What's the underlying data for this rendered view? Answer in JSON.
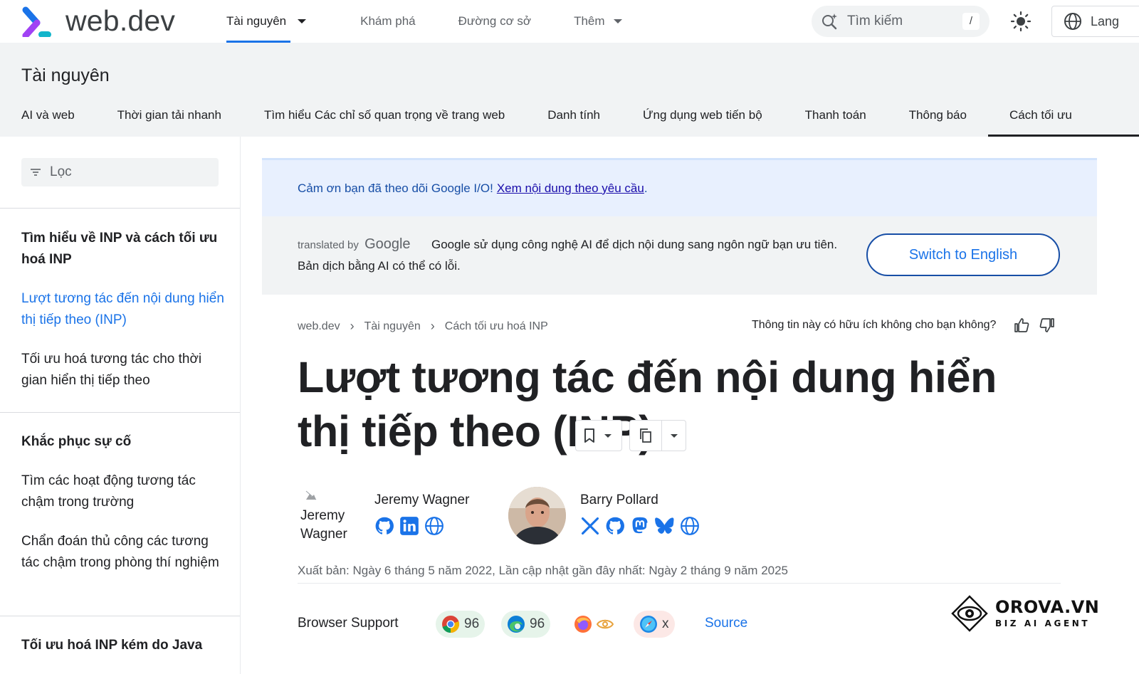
{
  "header": {
    "brand": "web.dev",
    "nav": [
      "Tài nguyên",
      "Khám phá",
      "Đường cơ sở",
      "Thêm"
    ],
    "search_placeholder": "Tìm kiếm",
    "search_shortcut": "/",
    "language_label": "Lang"
  },
  "section": {
    "title": "Tài nguyên",
    "tabs": [
      "AI và web",
      "Thời gian tải nhanh",
      "Tìm hiểu Các chỉ số quan trọng về trang web",
      "Danh tính",
      "Ứng dụng web tiến bộ",
      "Thanh toán",
      "Thông báo",
      "Cách tối ưu"
    ]
  },
  "sidebar": {
    "filter_placeholder": "Lọc",
    "group1_title": "Tìm hiểu về INP và cách tối ưu hoá INP",
    "item_active": "Lượt tương tác đến nội dung hiển thị tiếp theo (INP)",
    "item_optimize": "Tối ưu hoá tương tác cho thời gian hiển thị tiếp theo",
    "group2_title": "Khắc phục sự cố",
    "item_find_slow": "Tìm các hoạt động tương tác chậm trong trường",
    "item_diagnose": "Chẩn đoán thủ công các tương tác chậm trong phòng thí nghiệm",
    "group3_title": "Tối ưu hoá INP kém do Java"
  },
  "banner": {
    "text": "Cảm ơn bạn đã theo dõi Google I/O!",
    "link": "Xem nội dung theo yêu cầu",
    "end": "."
  },
  "translation": {
    "translated_by": "translated by",
    "google": "Google",
    "line1": "Google sử dụng công nghệ AI để dịch nội dung sang ngôn ngữ bạn ưu tiên.",
    "line2": "Bản dịch bằng AI có thể có lỗi.",
    "switch_button": "Switch to English"
  },
  "breadcrumb": [
    "web.dev",
    "Tài nguyên",
    "Cách tối ưu hoá INP"
  ],
  "helpful_question": "Thông tin này có hữu ích không cho bạn không?",
  "article": {
    "title": "Lượt tương tác đến nội dung hiển thị tiếp theo (INP)",
    "authors": [
      {
        "name": "Jeremy Wagner",
        "broken_alt": "Jeremy Wagner",
        "links": [
          "github-icon",
          "linkedin-icon",
          "globe-icon"
        ]
      },
      {
        "name": "Barry Pollard",
        "links": [
          "x-icon",
          "github-icon",
          "mastodon-icon",
          "bluesky-icon",
          "globe-icon"
        ]
      }
    ],
    "meta": "Xuất bản: Ngày 6 tháng 5 năm 2022, Lần cập nhật gần đây nhất: Ngày 2 tháng 9 năm 2025"
  },
  "browser_support": {
    "label": "Browser Support",
    "chrome": "96",
    "edge": "96",
    "firefox_status": "preview",
    "safari": "x",
    "source": "Source"
  },
  "watermark": {
    "name": "OROVA.VN",
    "tagline": "BIZ AI AGENT"
  },
  "colors": {
    "accent": "#1a73e8",
    "banner_bg": "#e8f0fe",
    "band_bg": "#f1f3f4"
  }
}
